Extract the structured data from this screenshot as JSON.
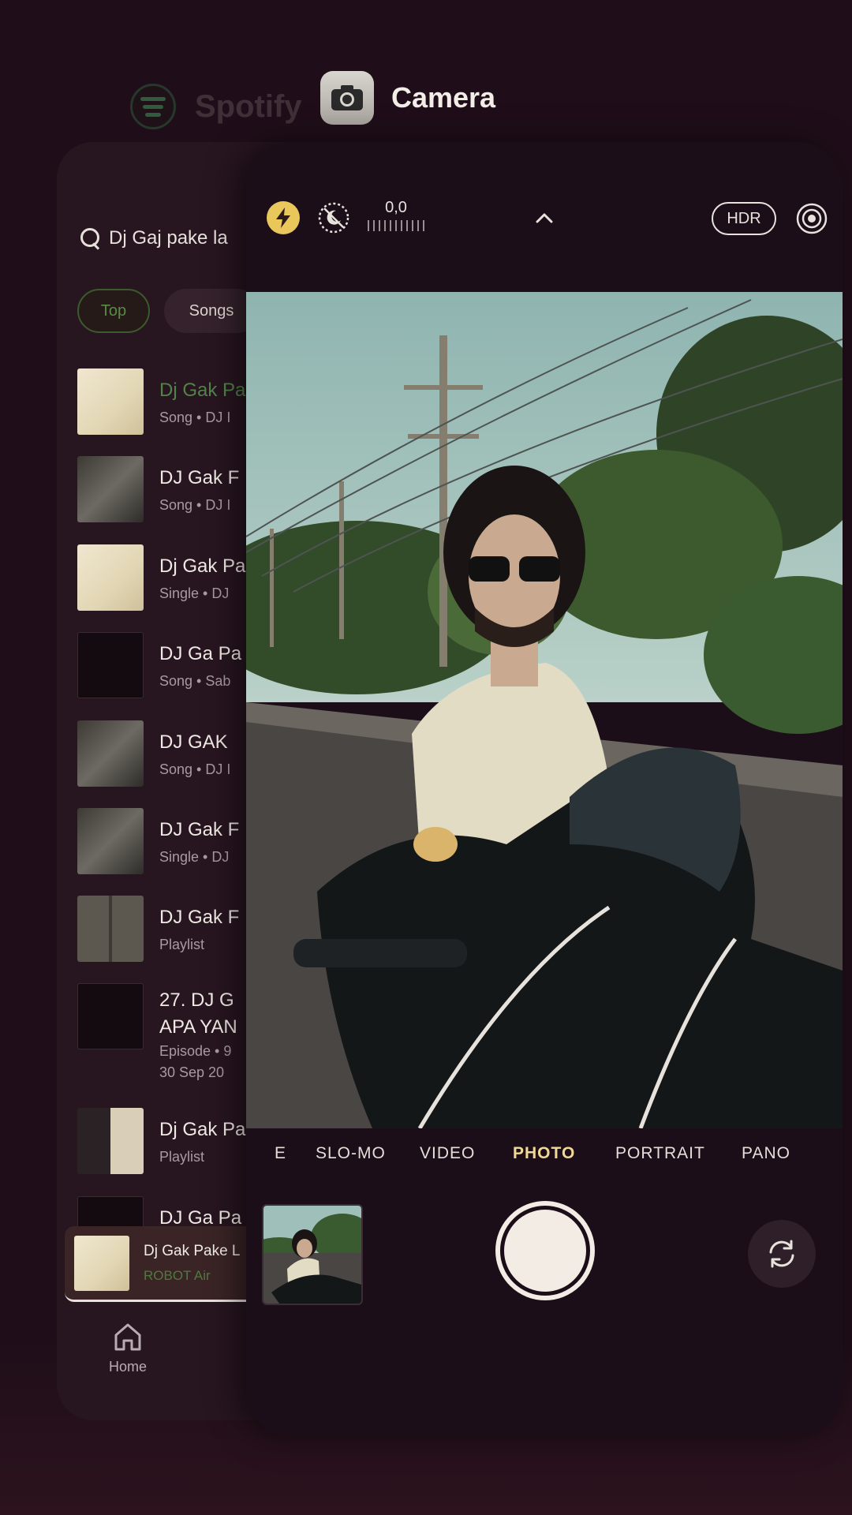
{
  "spotify": {
    "app_title": "Spotify",
    "search_query": "Dj Gaj pake la",
    "chips": [
      "Top",
      "Songs"
    ],
    "results": [
      {
        "title": "Dj Gak Pa",
        "subtitle": "Song • DJ I",
        "highlight": true
      },
      {
        "title": "DJ Gak F",
        "subtitle": "Song • DJ I"
      },
      {
        "title": "Dj Gak Pa",
        "subtitle": "Single • DJ"
      },
      {
        "title": "DJ Ga Pa",
        "subtitle": "Song • Sab"
      },
      {
        "title": "DJ GAK",
        "subtitle": "Song • DJ I"
      },
      {
        "title": "DJ Gak F",
        "subtitle": "Single • DJ"
      },
      {
        "title": "DJ Gak F",
        "subtitle": "Playlist"
      },
      {
        "title_line1": "27. DJ G",
        "title_line2": "APA YAN",
        "subtitle_line1": "Episode • 9",
        "subtitle_line2": "30 Sep 20"
      },
      {
        "title": "Dj Gak Pa",
        "subtitle": "Playlist"
      },
      {
        "title": "DJ Ga Pa"
      }
    ],
    "mini_player": {
      "title": "Dj Gak Pake L",
      "artist": "ROBOT Air"
    },
    "nav": {
      "home_label": "Home"
    }
  },
  "camera": {
    "app_title": "Camera",
    "exposure_value": "0,0",
    "hdr_label": "HDR",
    "modes": [
      "E",
      "SLO-MO",
      "VIDEO",
      "PHOTO",
      "PORTRAIT",
      "PANO"
    ],
    "active_mode": "PHOTO"
  },
  "colors": {
    "background": "#1f0e19",
    "flash_active": "#e9c75b",
    "active_mode": "#f0d895",
    "spotify_green": "#52844a"
  }
}
